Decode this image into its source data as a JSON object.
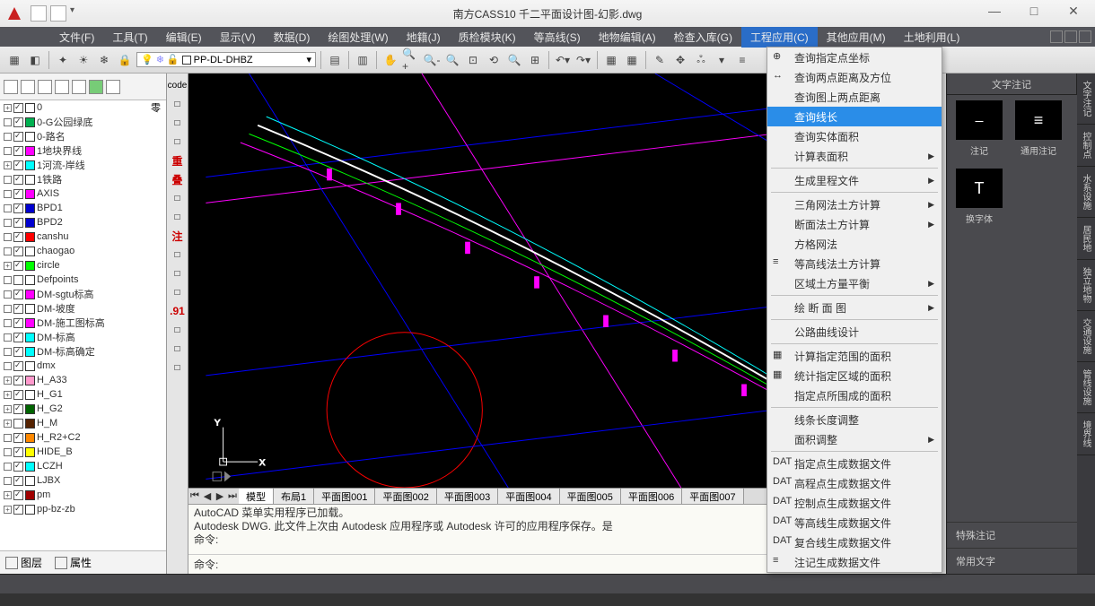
{
  "title": "南方CASS10     千二平面设计图-幻影.dwg",
  "window_buttons": {
    "min": "—",
    "max": "□",
    "close": "✕"
  },
  "menus": [
    "文件(F)",
    "工具(T)",
    "编辑(E)",
    "显示(V)",
    "数据(D)",
    "绘图处理(W)",
    "地籍(J)",
    "质检模块(K)",
    "等高线(S)",
    "地物编辑(A)",
    "检查入库(G)",
    "工程应用(C)",
    "其他应用(M)",
    "土地利用(L)"
  ],
  "active_menu_index": 11,
  "layer_combo": "PP-DL-DHBZ",
  "layers_header_extra": "零",
  "layers": [
    {
      "exp": "+",
      "ck": true,
      "color": "#ffffff",
      "name": "0"
    },
    {
      "exp": "",
      "ck": true,
      "color": "#00b050",
      "name": "0-G公园绿底"
    },
    {
      "exp": "",
      "ck": true,
      "color": "#ffffff",
      "name": "0-路名"
    },
    {
      "exp": "",
      "ck": true,
      "color": "#ff00ff",
      "name": "1地块界线"
    },
    {
      "exp": "+",
      "ck": true,
      "color": "#00ffff",
      "name": "1河流-岸线"
    },
    {
      "exp": "",
      "ck": true,
      "color": "#ffffff",
      "name": "1铁路"
    },
    {
      "exp": "",
      "ck": true,
      "color": "#ff00ff",
      "name": "AXIS"
    },
    {
      "exp": "",
      "ck": true,
      "color": "#0000d0",
      "name": "BPD1"
    },
    {
      "exp": "",
      "ck": true,
      "color": "#0000d0",
      "name": "BPD2"
    },
    {
      "exp": "",
      "ck": true,
      "color": "#ff0000",
      "name": "canshu"
    },
    {
      "exp": "",
      "ck": true,
      "color": "#ffffff",
      "name": "chaogao"
    },
    {
      "exp": "+",
      "ck": true,
      "color": "#00ff00",
      "name": "circle"
    },
    {
      "exp": "",
      "ck": false,
      "color": "#ffffff",
      "name": "Defpoints"
    },
    {
      "exp": "",
      "ck": true,
      "color": "#ff00ff",
      "name": "DM-sgtu标高"
    },
    {
      "exp": "",
      "ck": true,
      "color": "#ffffff",
      "name": "DM-坡度"
    },
    {
      "exp": "",
      "ck": true,
      "color": "#ff00ff",
      "name": "DM-施工图标高"
    },
    {
      "exp": "",
      "ck": true,
      "color": "#00ffff",
      "name": "DM-标高"
    },
    {
      "exp": "",
      "ck": true,
      "color": "#00ffff",
      "name": "DM-标高确定"
    },
    {
      "exp": "",
      "ck": true,
      "color": "#ffffff",
      "name": "dmx"
    },
    {
      "exp": "+",
      "ck": true,
      "color": "#ff99cc",
      "name": "H_A33"
    },
    {
      "exp": "+",
      "ck": true,
      "color": "#ffffff",
      "name": "H_G1"
    },
    {
      "exp": "+",
      "ck": true,
      "color": "#006400",
      "name": "H_G2"
    },
    {
      "exp": "+",
      "ck": false,
      "color": "#552200",
      "name": "H_M"
    },
    {
      "exp": "",
      "ck": true,
      "color": "#ff8800",
      "name": "H_R2+C2"
    },
    {
      "exp": "",
      "ck": true,
      "color": "#ffff00",
      "name": "HIDE_B"
    },
    {
      "exp": "",
      "ck": true,
      "color": "#00ffff",
      "name": "LCZH"
    },
    {
      "exp": "",
      "ck": true,
      "color": "#ffffff",
      "name": "LJBX"
    },
    {
      "exp": "+",
      "ck": true,
      "color": "#a00000",
      "name": "pm"
    },
    {
      "exp": "+",
      "ck": true,
      "color": "#ffffff",
      "name": "pp-bz-zb"
    }
  ],
  "layers_bottom": {
    "t1": "图层",
    "t2": "属性"
  },
  "vtool_labels": [
    "code",
    "",
    "",
    "",
    "重",
    "叠",
    "",
    "",
    "注",
    "",
    "",
    "",
    ".91",
    "",
    "",
    ""
  ],
  "tabs": [
    "模型",
    "布局1",
    "平面图001",
    "平面图002",
    "平面图003",
    "平面图004",
    "平面图005",
    "平面图006",
    "平面图007"
  ],
  "cmd_text": {
    "l1": "AutoCAD 菜单实用程序已加载。",
    "l2": "Autodesk DWG.   此文件上次由 Autodesk 应用程序或 Autodesk 许可的应用程序保存。是",
    "l3": "命令:",
    "prompt": "命令:"
  },
  "dropdown": [
    {
      "t": "item",
      "label": "查询指定点坐标",
      "icon": "⊕"
    },
    {
      "t": "item",
      "label": "查询两点距离及方位",
      "icon": "↔"
    },
    {
      "t": "item",
      "label": "查询图上两点距离",
      "icon": ""
    },
    {
      "t": "item",
      "label": "查询线长",
      "hl": true
    },
    {
      "t": "item",
      "label": "查询实体面积"
    },
    {
      "t": "item",
      "label": "计算表面积",
      "arrow": true
    },
    {
      "t": "sep"
    },
    {
      "t": "item",
      "label": "生成里程文件",
      "arrow": true
    },
    {
      "t": "sep"
    },
    {
      "t": "item",
      "label": "三角网法土方计算",
      "arrow": true
    },
    {
      "t": "item",
      "label": "断面法土方计算",
      "arrow": true
    },
    {
      "t": "item",
      "label": "方格网法"
    },
    {
      "t": "item",
      "label": "等高线法土方计算",
      "icon": "≡"
    },
    {
      "t": "item",
      "label": "区域土方量平衡",
      "arrow": true
    },
    {
      "t": "sep"
    },
    {
      "t": "item",
      "label": "绘 断 面 图",
      "arrow": true
    },
    {
      "t": "sep"
    },
    {
      "t": "item",
      "label": "公路曲线设计"
    },
    {
      "t": "sep"
    },
    {
      "t": "item",
      "label": "计算指定范围的面积",
      "icon": "▦"
    },
    {
      "t": "item",
      "label": "统计指定区域的面积",
      "icon": "▦"
    },
    {
      "t": "item",
      "label": "指定点所围成的面积"
    },
    {
      "t": "sep"
    },
    {
      "t": "item",
      "label": "线条长度调整"
    },
    {
      "t": "item",
      "label": "面积调整",
      "arrow": true
    },
    {
      "t": "sep"
    },
    {
      "t": "item",
      "label": "指定点生成数据文件",
      "icon": "DAT"
    },
    {
      "t": "item",
      "label": "高程点生成数据文件",
      "icon": "DAT"
    },
    {
      "t": "item",
      "label": "控制点生成数据文件",
      "icon": "DAT"
    },
    {
      "t": "item",
      "label": "等高线生成数据文件",
      "icon": "DAT"
    },
    {
      "t": "item",
      "label": "复合线生成数据文件",
      "icon": "DAT"
    },
    {
      "t": "item",
      "label": "注记生成数据文件",
      "icon": "≡"
    }
  ],
  "right_panel": {
    "header": "文字注记",
    "tiles": [
      {
        "icon": "⎯",
        "label": "注记"
      },
      {
        "icon": "≡",
        "label": "通用注记"
      },
      {
        "icon": "T",
        "label": "换字体"
      }
    ],
    "sections": [
      "特殊注记",
      "常用文字"
    ]
  },
  "right_edge_tabs": [
    "文字注记",
    "控制点",
    "水系设施",
    "居民地",
    "独立地物",
    "交通设施",
    "管线设施",
    "境界线"
  ]
}
